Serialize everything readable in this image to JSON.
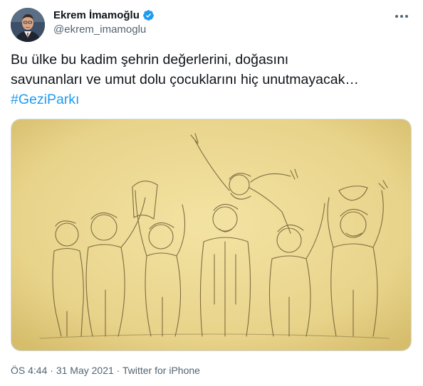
{
  "user": {
    "display_name": "Ekrem İmamoğlu",
    "handle": "@ekrem_imamoglu",
    "verified": true
  },
  "tweet": {
    "text_line1": "Bu ülke bu kadim şehrin değerlerini, doğasını",
    "text_line2": "savunanları ve umut dolu çocuklarını hiç unutmayacak…",
    "hashtag": "#GeziParkı"
  },
  "media": {
    "image_icon": "sketch-illustration-image"
  },
  "meta": {
    "time": "ÖS 4:44",
    "separator1": " · ",
    "date": "31 May 2021",
    "separator2": " · ",
    "source": "Twitter for iPhone"
  },
  "colors": {
    "link": "#1d9bf0",
    "secondary_text": "#536471",
    "verified_badge": "#1d9bf0",
    "sketch_background": "#e8d38a"
  },
  "icons": {
    "more": "more-options-icon",
    "verified": "verified-badge-icon"
  }
}
